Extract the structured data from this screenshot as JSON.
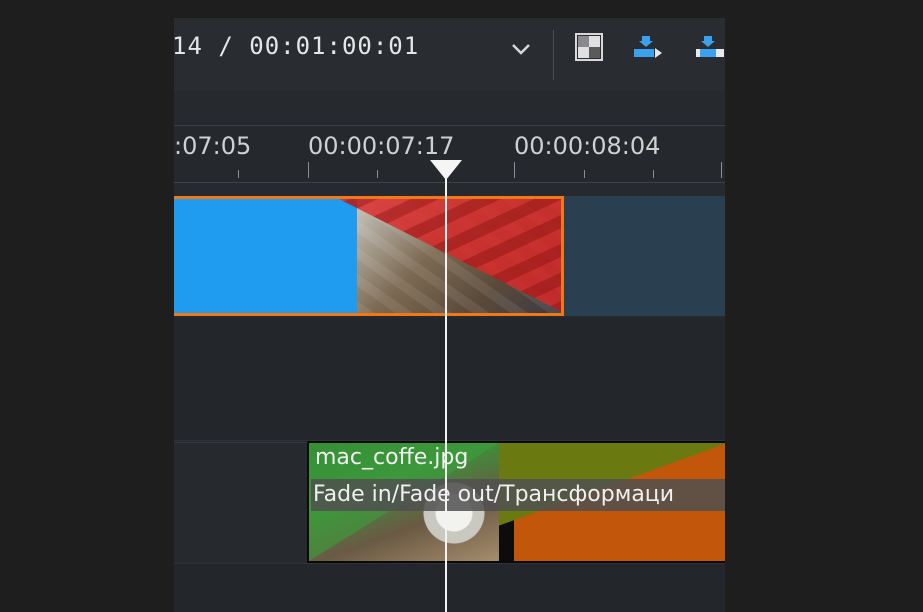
{
  "toolbar": {
    "timecode": "14 / 00:01:00:01",
    "icons": [
      "chevron-down-icon",
      "checker-icon",
      "insert-icon",
      "overwrite-icon"
    ]
  },
  "ruler": {
    "labels": [
      ":07:05",
      "00:00:07:17",
      "00:00:08:04"
    ]
  },
  "tracks": {
    "audio_clip": {
      "name": "mac_coffe.jpg",
      "effects": "Fade in/Fade out/Трансформаци"
    }
  },
  "colors": {
    "selection_border": "#f07818",
    "clip_blue": "#1f9cf0",
    "transition_red": "#dc2828",
    "playhead": "#f2f2f2"
  }
}
